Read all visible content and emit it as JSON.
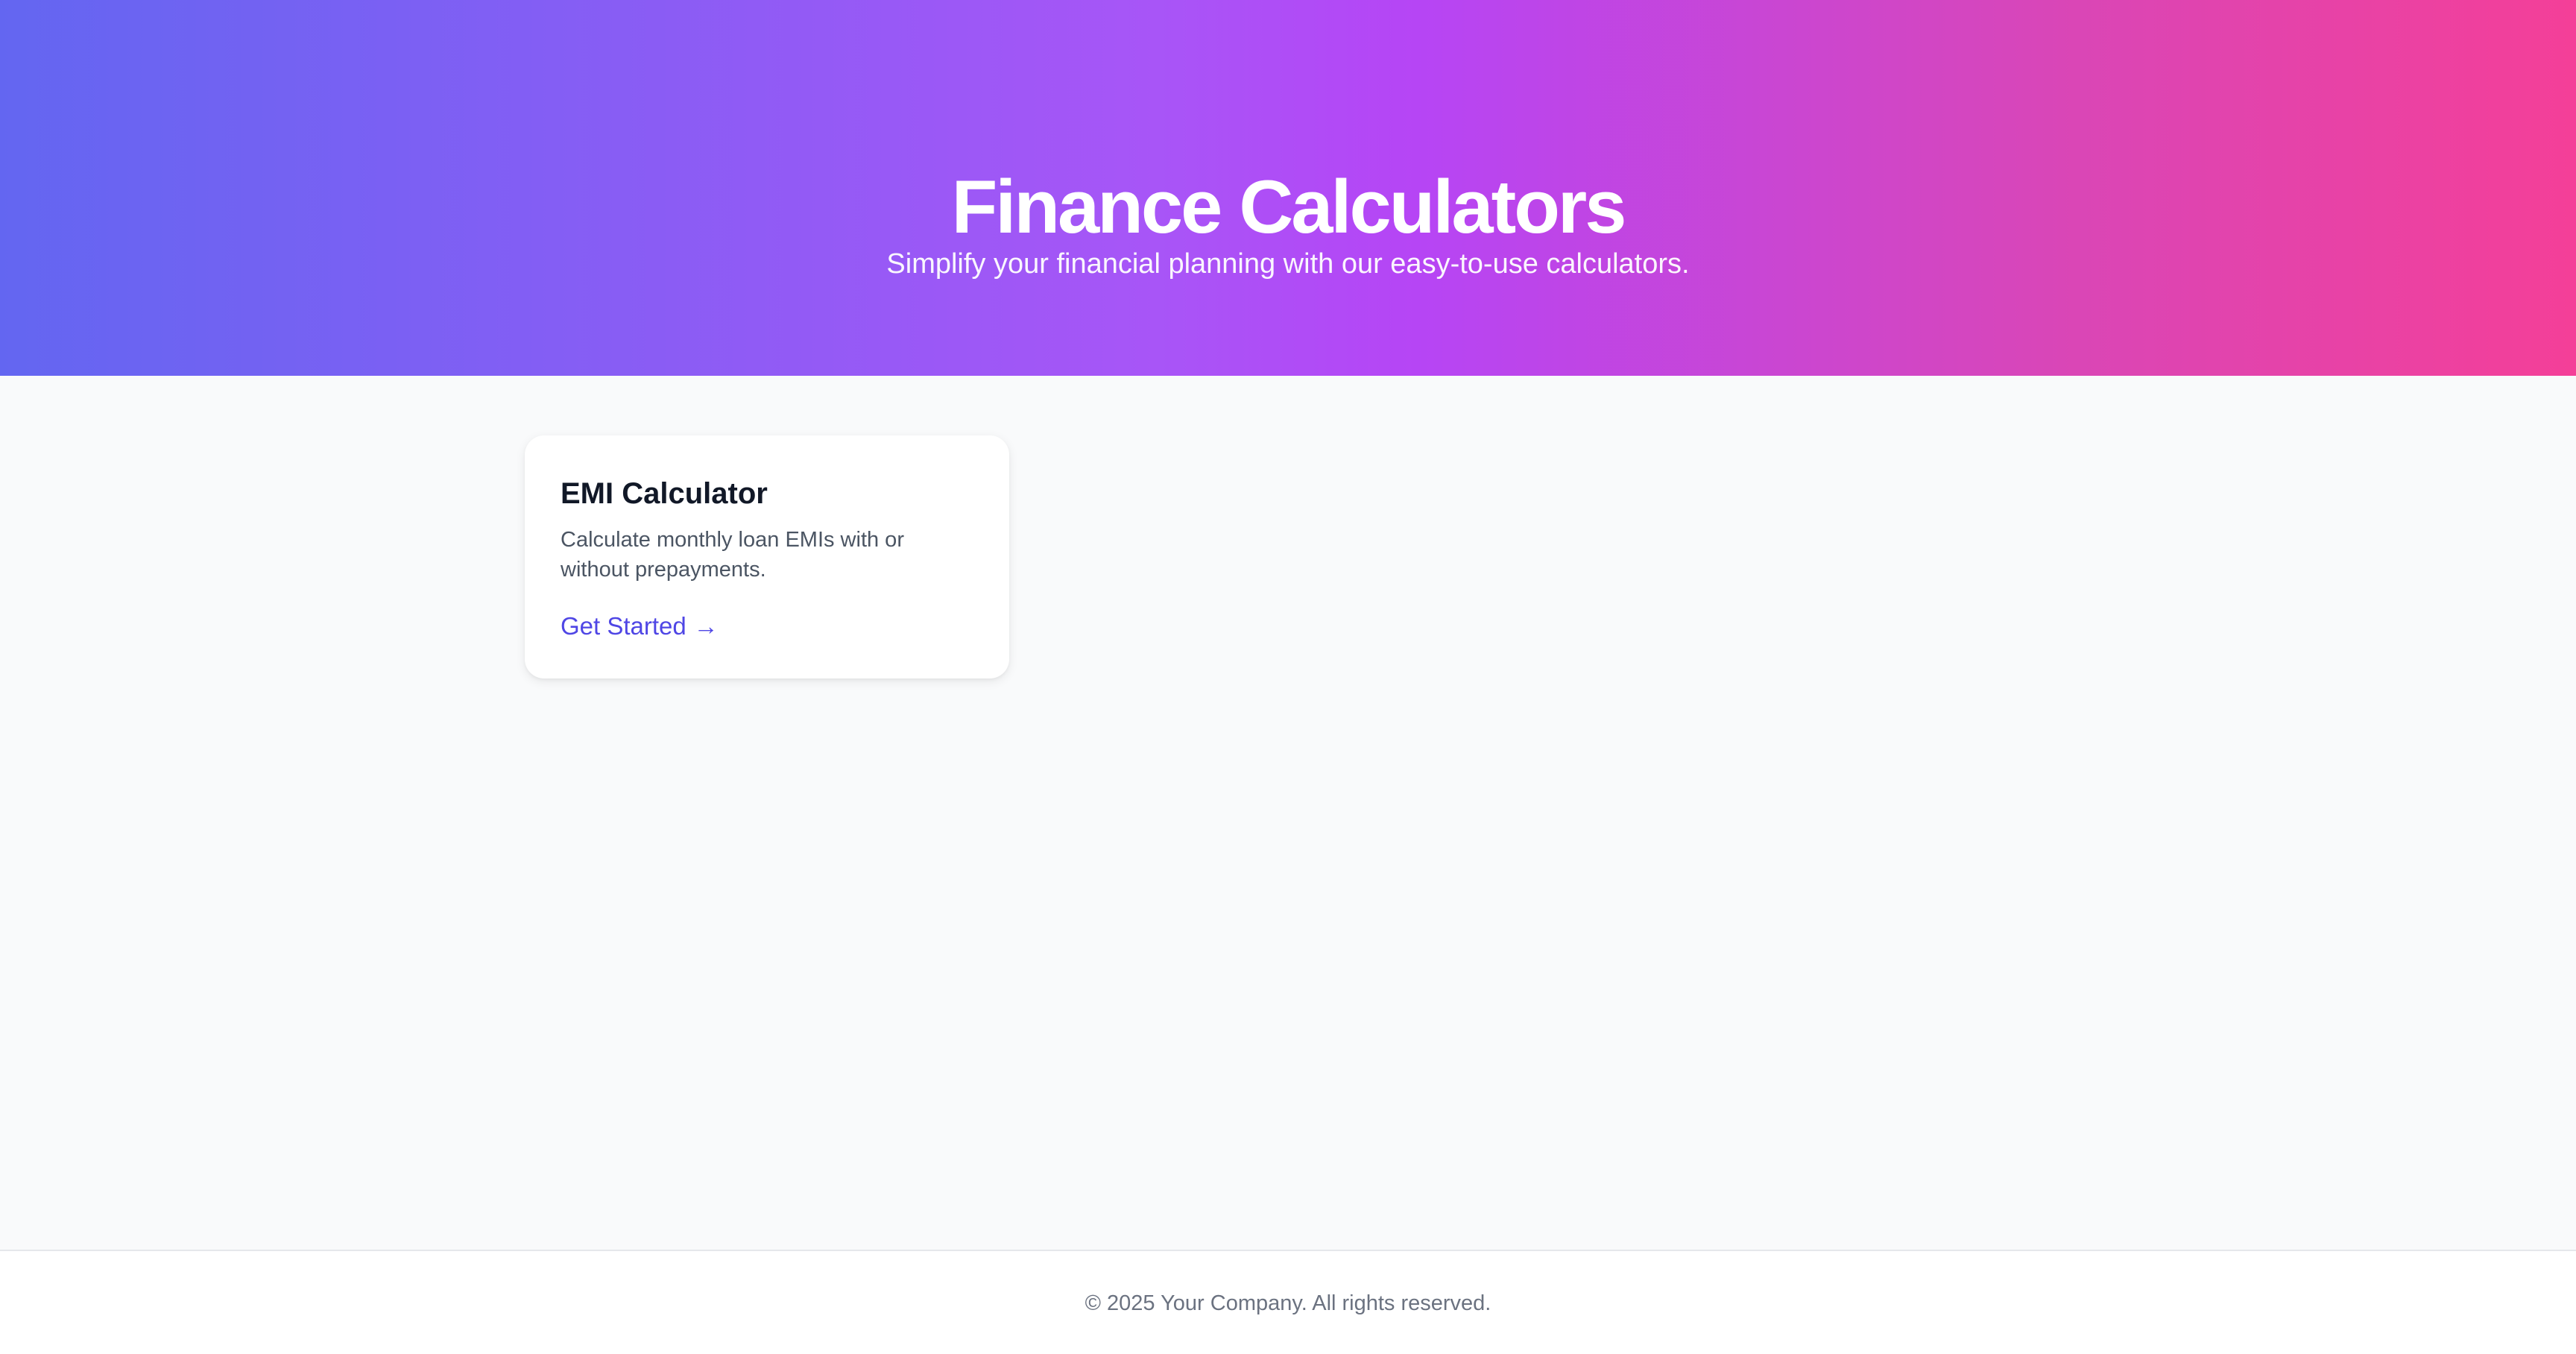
{
  "hero": {
    "title": "Finance Calculators",
    "subtitle": "Simplify your financial planning with our easy-to-use calculators."
  },
  "cards": [
    {
      "title": "EMI Calculator",
      "description": "Calculate monthly loan EMIs with or without prepayments.",
      "link_label": "Get Started",
      "link_icon": "arrow-right-icon",
      "link_glyph": "→"
    }
  ],
  "footer": {
    "text": "© 2025 Your Company. All rights reserved."
  },
  "colors": {
    "gradient_start": "#6366f1",
    "gradient_mid": "#a855f7",
    "gradient_end": "#f43f98",
    "link": "#4f46e5",
    "page_background": "#f9fafb"
  }
}
